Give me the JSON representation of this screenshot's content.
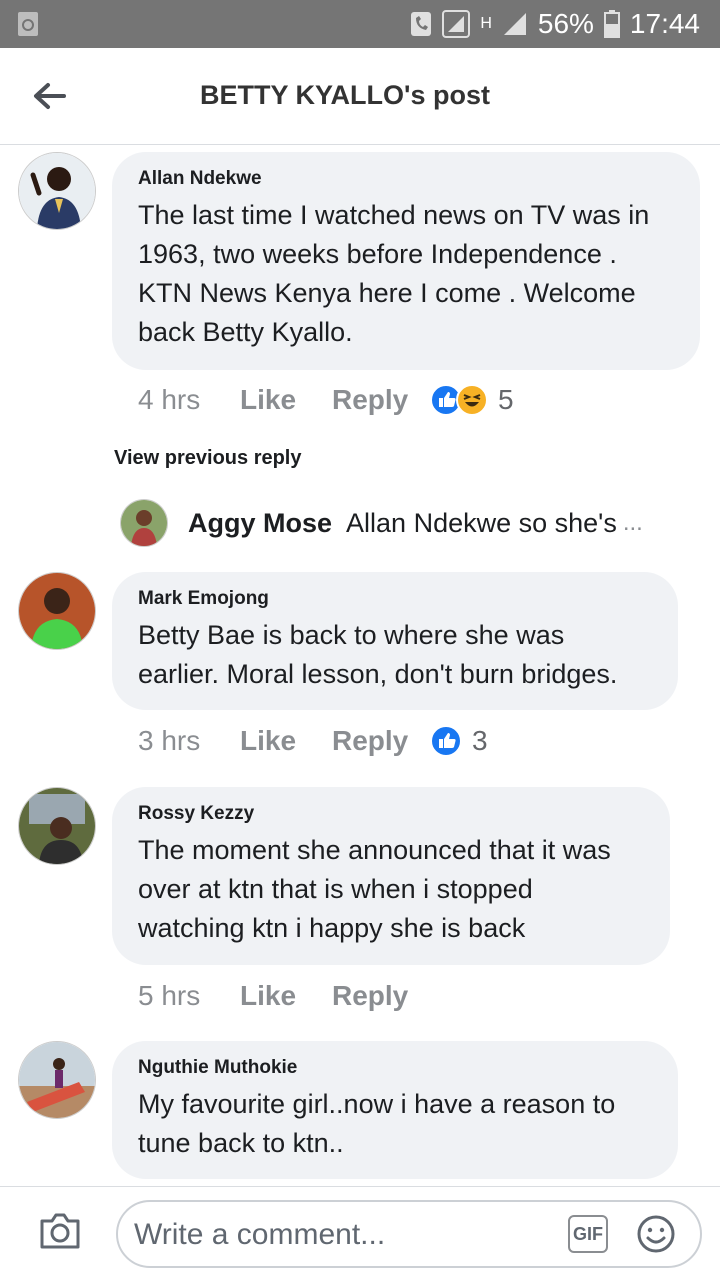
{
  "status_bar": {
    "battery": "56%",
    "time": "17:44",
    "network": "H"
  },
  "header": {
    "title": "BETTY KYALLO's post"
  },
  "comments": [
    {
      "name": "Allan Ndekwe",
      "text": "The last time I watched news on TV was in 1963, two weeks before Independence . KTN News Kenya here I come . Welcome back Betty Kyallo.",
      "time": "4 hrs",
      "like": "Like",
      "reply": "Reply",
      "reactions": "5"
    },
    {
      "name": "Mark Emojong",
      "text": "Betty Bae is back to where she was earlier. Moral lesson, don't burn bridges.",
      "time": "3 hrs",
      "like": "Like",
      "reply": "Reply",
      "reactions": "3"
    },
    {
      "name": "Rossy Kezzy",
      "text": "The moment she announced that it was over at ktn that is when i stopped watching ktn i happy she is back",
      "time": "5 hrs",
      "like": "Like",
      "reply": "Reply"
    },
    {
      "name": "Nguthie Muthokie",
      "text": "My favourite girl..now i have a reason to tune back to ktn.."
    }
  ],
  "view_previous": "View previous reply",
  "sub_reply": {
    "name": "Aggy Mose",
    "text": "Allan Ndekwe so she's",
    "ellipsis": "..."
  },
  "composer": {
    "placeholder": "Write a comment...",
    "gif": "GIF"
  },
  "icons": [
    "back-arrow-icon",
    "camera-icon",
    "gif-icon",
    "emoji-icon",
    "like-reaction-icon",
    "haha-reaction-icon"
  ],
  "colors": {
    "status_bar": "#757575",
    "bubble": "#f0f2f5",
    "like_blue": "#1877f2",
    "meta_gray": "#8a8d91"
  }
}
